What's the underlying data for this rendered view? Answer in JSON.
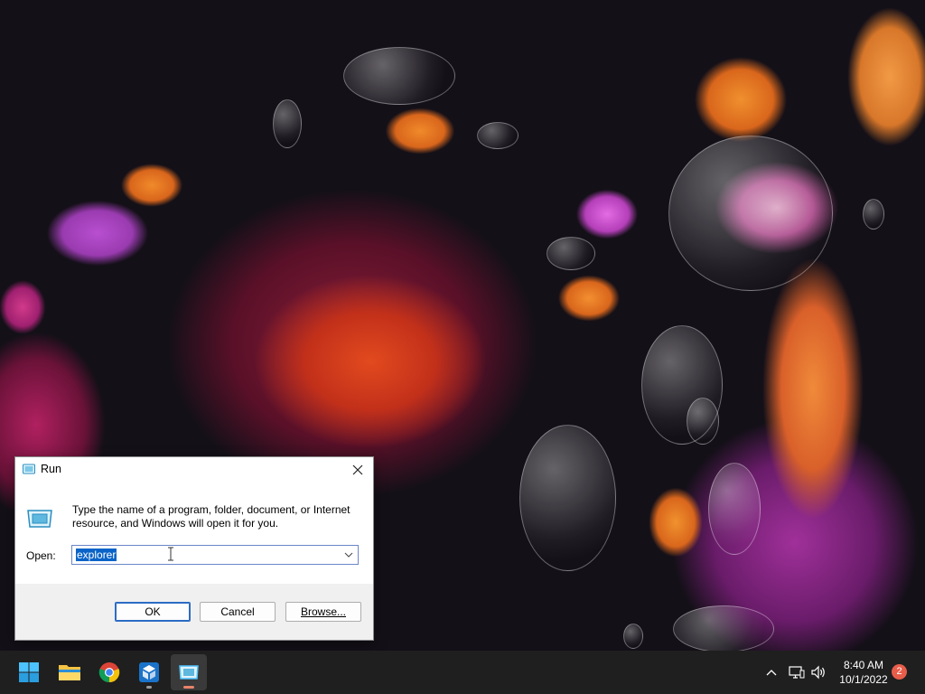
{
  "dialog": {
    "title": "Run",
    "description": "Type the name of a program, folder, document, or Internet resource, and Windows will open it for you.",
    "open_label": "Open:",
    "open_value": "explorer",
    "ok_label": "OK",
    "cancel_label": "Cancel",
    "browse_label": "Browse..."
  },
  "taskbar": {
    "apps": [
      {
        "name": "Start",
        "icon": "windows-logo-icon"
      },
      {
        "name": "File Explorer",
        "icon": "folder-icon"
      },
      {
        "name": "Google Chrome",
        "icon": "chrome-icon"
      },
      {
        "name": "App",
        "icon": "cube-icon"
      },
      {
        "name": "Run",
        "icon": "run-icon",
        "active": true
      }
    ],
    "clock_time": "8:40 AM",
    "clock_date": "10/1/2022",
    "notification_count": "2"
  },
  "colors": {
    "accent": "#0a64c8",
    "taskbar": "#1f1f1f",
    "badge": "#e85d4a"
  }
}
